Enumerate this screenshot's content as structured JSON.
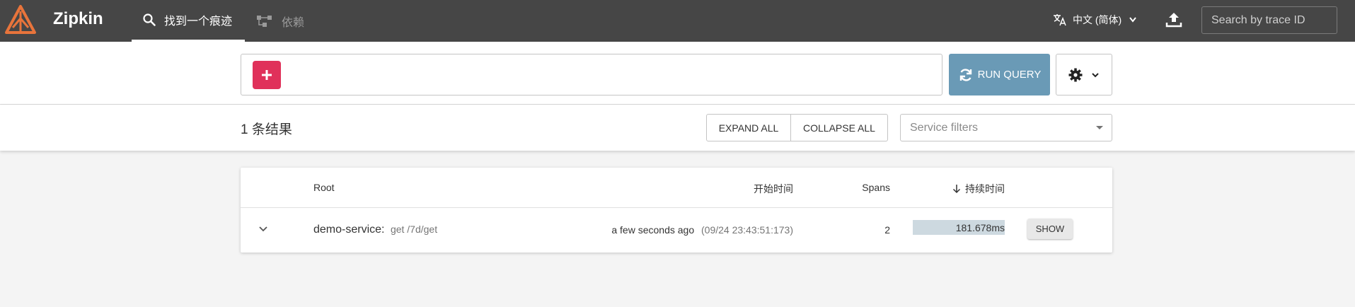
{
  "header": {
    "brand": "Zipkin",
    "nav": [
      {
        "label": "找到一个痕迹",
        "icon": "search-icon",
        "active": true
      },
      {
        "label": "依赖",
        "icon": "dependencies-icon",
        "active": false
      }
    ],
    "language": "中文 (简体)",
    "trace_search_placeholder": "Search by trace ID"
  },
  "query": {
    "run_label": "RUN QUERY"
  },
  "results": {
    "count_label": "1 条结果",
    "expand_all": "EXPAND ALL",
    "collapse_all": "COLLAPSE ALL",
    "service_filter_placeholder": "Service filters"
  },
  "table": {
    "headers": {
      "root": "Root",
      "start_time": "开始时间",
      "spans": "Spans",
      "duration": "持续时间"
    },
    "rows": [
      {
        "service": "demo-service:",
        "span_name": "get /7d/get",
        "relative_time": "a few seconds ago",
        "absolute_time": "(09/24 23:43:51:173)",
        "spans": "2",
        "duration": "181.678ms",
        "duration_fraction": 1.0,
        "show_label": "SHOW"
      }
    ]
  },
  "colors": {
    "header_bg": "#464646",
    "accent_add": "#e0315a",
    "run_button": "#6a9ab6",
    "logo": "#e8743b"
  }
}
